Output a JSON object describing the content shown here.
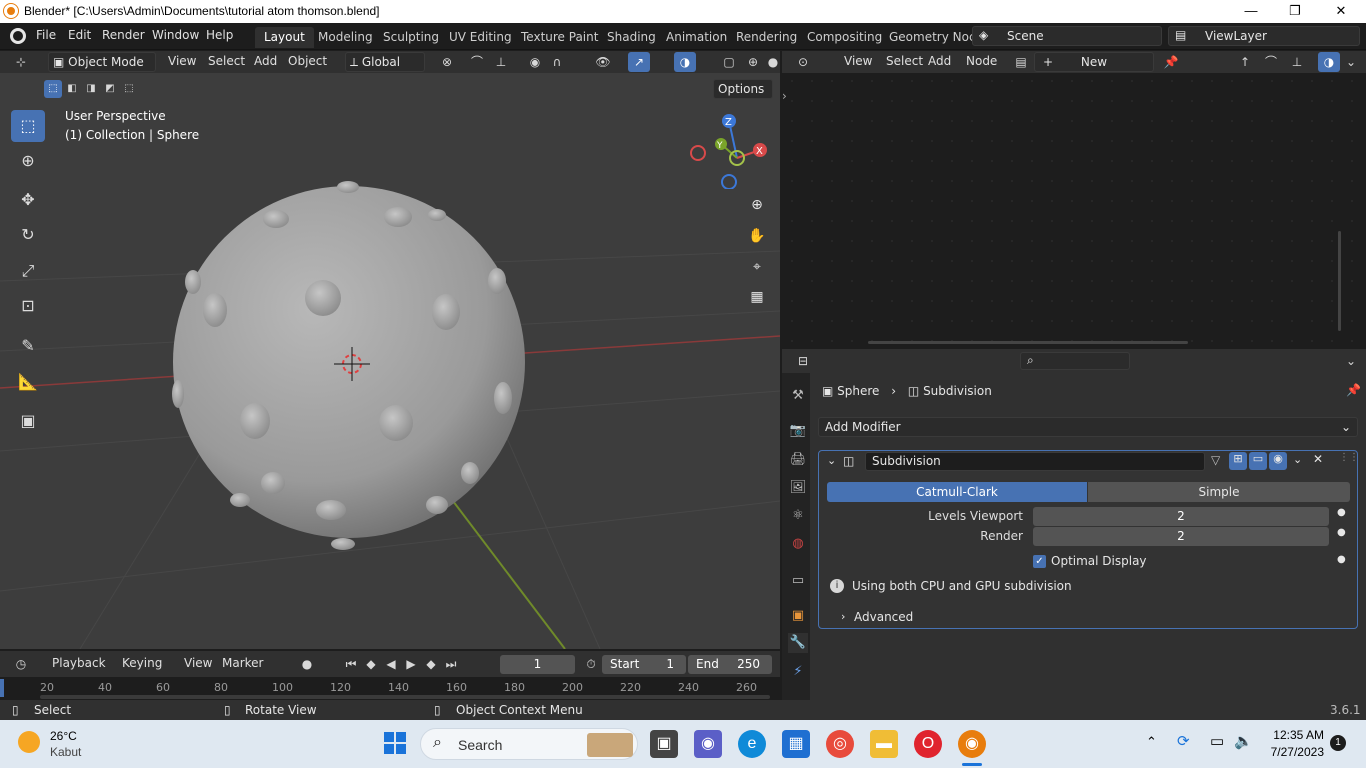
{
  "window": {
    "title": "Blender* [C:\\Users\\Admin\\Documents\\tutorial atom thomson.blend]",
    "min": "—",
    "max": "❐",
    "close": "✕"
  },
  "menu": [
    "File",
    "Edit",
    "Render",
    "Window",
    "Help"
  ],
  "workspaces": [
    "Layout",
    "Modeling",
    "Sculpting",
    "UV Editing",
    "Texture Paint",
    "Shading",
    "Animation",
    "Rendering",
    "Compositing",
    "Geometry Noc"
  ],
  "scene": "Scene",
  "view_layer": "ViewLayer",
  "viewport": {
    "mode": "Object Mode",
    "menus": [
      "View",
      "Select",
      "Add",
      "Object"
    ],
    "orientation": "Global",
    "options": "Options",
    "overlay_title": "User Perspective",
    "overlay_sub": "(1) Collection | Sphere",
    "gizmo": {
      "z": "Z",
      "y": "Y",
      "x": "X"
    }
  },
  "node_editor": {
    "menus": [
      "View",
      "Select",
      "Add",
      "Node"
    ],
    "new_label": "New"
  },
  "properties": {
    "breadcrumb": {
      "object": "Sphere",
      "modifier": "Subdivision"
    },
    "add_modifier": "Add Modifier",
    "modifier_name": "Subdivision",
    "tabs": [
      "Catmull-Clark",
      "Simple"
    ],
    "levels_viewport_label": "Levels Viewport",
    "levels_viewport_value": "2",
    "render_label": "Render",
    "render_value": "2",
    "optimal_display": "Optimal Display",
    "info": "Using both CPU and GPU subdivision",
    "advanced": "Advanced"
  },
  "timeline": {
    "menus": [
      "Playback",
      "Keying",
      "View",
      "Marker"
    ],
    "current_frame": "1",
    "start_label": "Start",
    "start_value": "1",
    "end_label": "End",
    "end_value": "250",
    "ruler": [
      "20",
      "40",
      "60",
      "80",
      "100",
      "120",
      "140",
      "160",
      "180",
      "200",
      "220",
      "240",
      "260"
    ]
  },
  "status": {
    "select": "Select",
    "rotate": "Rotate View",
    "context": "Object Context Menu",
    "version": "3.6.1"
  },
  "taskbar": {
    "weather_temp": "26°C",
    "weather_desc": "Kabut",
    "search": "Search",
    "time": "12:35 AM",
    "date": "7/27/2023",
    "notif": "1"
  },
  "colors": {
    "accent": "#4772b3",
    "header": "#303030",
    "viewport_bg": "#3d3d3d",
    "panel_bg": "#303030"
  }
}
